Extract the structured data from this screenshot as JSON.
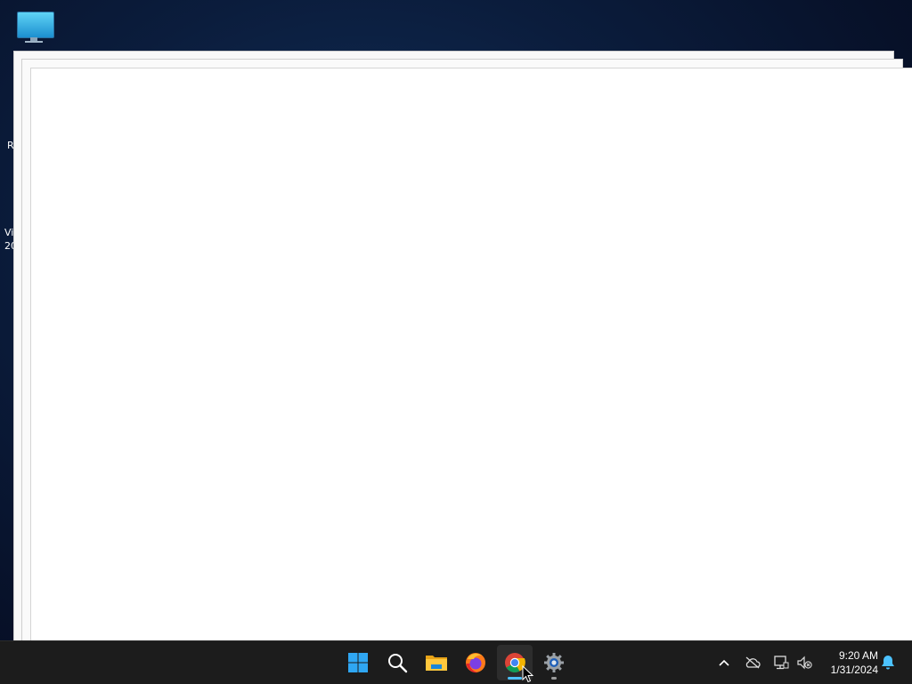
{
  "desktop": {
    "icons": [
      {
        "name": "This PC"
      }
    ],
    "clipped_labels": [
      {
        "text": "R"
      },
      {
        "text": "Vi"
      },
      {
        "text": "20"
      }
    ]
  },
  "windows": [
    {
      "name": "background-window-1"
    },
    {
      "name": "background-window-2"
    },
    {
      "name": "foreground-window"
    }
  ],
  "taskbar": {
    "apps": [
      {
        "id": "start",
        "icon": "windows-logo-icon",
        "active": false
      },
      {
        "id": "search",
        "icon": "search-icon",
        "active": false
      },
      {
        "id": "file-explorer",
        "icon": "folder-icon",
        "active": false
      },
      {
        "id": "firefox",
        "icon": "firefox-icon",
        "active": false
      },
      {
        "id": "chrome",
        "icon": "chrome-icon",
        "active": true
      },
      {
        "id": "settings",
        "icon": "gear-icon",
        "active": false
      }
    ],
    "tray": {
      "icons": [
        "chevron-up-icon",
        "cloud-offline-icon",
        "network-icon",
        "volume-muted-icon",
        "notification-bell-icon"
      ]
    },
    "clock": {
      "time": "9:20 AM",
      "date": "1/31/2024"
    }
  },
  "colors": {
    "taskbar_bg": "#1c1c1c",
    "accent": "#4cc2ff",
    "desktop_bg": "#0b1d3d"
  }
}
